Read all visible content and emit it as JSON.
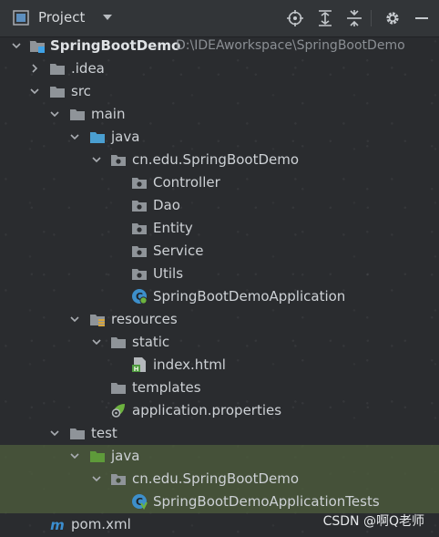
{
  "header": {
    "title": "Project",
    "icons": [
      "project-view-icon",
      "dropdown-caret-icon",
      "locate-icon",
      "expand-all-icon",
      "collapse-all-icon",
      "settings-gear-icon",
      "hide-icon"
    ]
  },
  "tree": {
    "root": {
      "label": "SpringBootDemo",
      "path": "D:\\IDEAworkspace\\SpringBootDemo"
    },
    "idea": ".idea",
    "src": "src",
    "main": "main",
    "java": "java",
    "package": "cn.edu.SpringBootDemo",
    "controller": "Controller",
    "dao": "Dao",
    "entity": "Entity",
    "service": "Service",
    "utils": "Utils",
    "app_class": "SpringBootDemoApplication",
    "resources": "resources",
    "static": "static",
    "index_html": "index.html",
    "templates": "templates",
    "app_props": "application.properties",
    "test": "test",
    "test_java": "java",
    "test_package": "cn.edu.SpringBootDemo",
    "test_class": "SpringBootDemoApplicationTests",
    "pom": "pom.xml"
  },
  "colors": {
    "background": "#2a2c2f",
    "header": "#323538",
    "selection": "#4d5c3c",
    "folder": "#8f9499",
    "source_folder": "#4a9fd1",
    "test_folder": "#5e9a3a",
    "spring_green": "#6db33f"
  },
  "watermark": "CSDN @啊Q老师"
}
